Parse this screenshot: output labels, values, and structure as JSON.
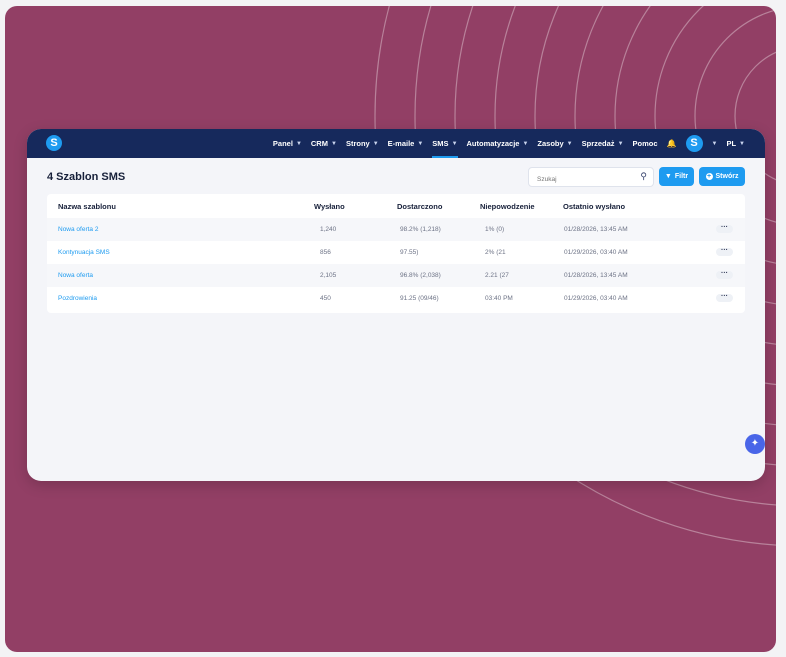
{
  "brand": {
    "logo_letter": "S"
  },
  "nav": {
    "items": [
      {
        "label": "Panel",
        "chevron": true,
        "active": false
      },
      {
        "label": "CRM",
        "chevron": true,
        "active": false
      },
      {
        "label": "Strony",
        "chevron": true,
        "active": false
      },
      {
        "label": "E-maile",
        "chevron": true,
        "active": false
      },
      {
        "label": "SMS",
        "chevron": true,
        "active": true
      },
      {
        "label": "Automatyzacje",
        "chevron": true,
        "active": false
      },
      {
        "label": "Zasoby",
        "chevron": true,
        "active": false
      },
      {
        "label": "Sprzedaż",
        "chevron": true,
        "active": false
      },
      {
        "label": "Pomoc",
        "chevron": false,
        "active": false
      }
    ],
    "avatar_letter": "S",
    "language": "PL"
  },
  "page": {
    "title": "4 Szablon SMS",
    "search_placeholder": "Szukaj",
    "filter_label": "Filtr",
    "create_label": "Stwórz"
  },
  "table": {
    "headers": [
      "Nazwa szablonu",
      "Wysłano",
      "Dostarczono",
      "Niepowodzenie",
      "Ostatnio wysłano"
    ],
    "rows": [
      {
        "name": "Nowa oferta 2",
        "sent": "1,240",
        "delivered": "98.2% (1,218)",
        "failed": "1% (0)",
        "last_sent": "01/28/2026, 13:45 AM"
      },
      {
        "name": "Kontynuacja SMS",
        "sent": "856",
        "delivered": "97.55)",
        "failed": "2% (21",
        "last_sent": "01/29/2026, 03:40 AM"
      },
      {
        "name": "Nowa oferta",
        "sent": "2,105",
        "delivered": "96.8% (2,038)",
        "failed": "2.21 (27",
        "last_sent": "01/28/2026, 13:45 AM"
      },
      {
        "name": "Pozdrowienia",
        "sent": "450",
        "delivered": "91.25 (09/46)",
        "failed": "03:40 PM",
        "last_sent": "01/29/2026, 03:40 AM"
      }
    ]
  },
  "colors": {
    "background": "#923f65",
    "topbar": "#16295c",
    "accent": "#1e9bf0"
  }
}
